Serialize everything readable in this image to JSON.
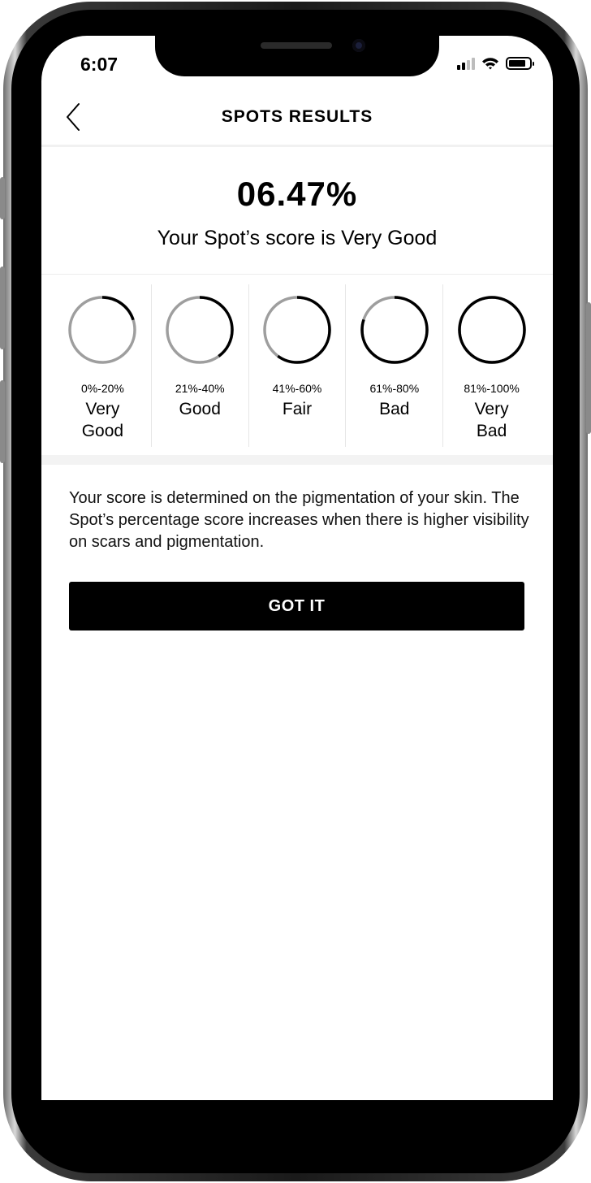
{
  "status_bar": {
    "time": "6:07"
  },
  "nav": {
    "title": "SPOTS RESULTS"
  },
  "score": {
    "value": "06.47%",
    "summary": "Your Spot’s score is Very Good"
  },
  "ranges": [
    {
      "percent": "0%-20%",
      "label": "Very Good",
      "fill": 0.2
    },
    {
      "percent": "21%-40%",
      "label": "Good",
      "fill": 0.4
    },
    {
      "percent": "41%-60%",
      "label": "Fair",
      "fill": 0.6
    },
    {
      "percent": "61%-80%",
      "label": "Bad",
      "fill": 0.8
    },
    {
      "percent": "81%-100%",
      "label": "Very Bad",
      "fill": 1.0
    }
  ],
  "explanation": "Your score is determined on the pigmentation of your skin. The Spot’s percentage score increases when there is higher visibility on scars and pigmentation.",
  "primary_button": {
    "label": "GOT IT"
  },
  "colors": {
    "accent": "#000000",
    "track": "#9e9e9e",
    "button_text": "#ffffff"
  }
}
